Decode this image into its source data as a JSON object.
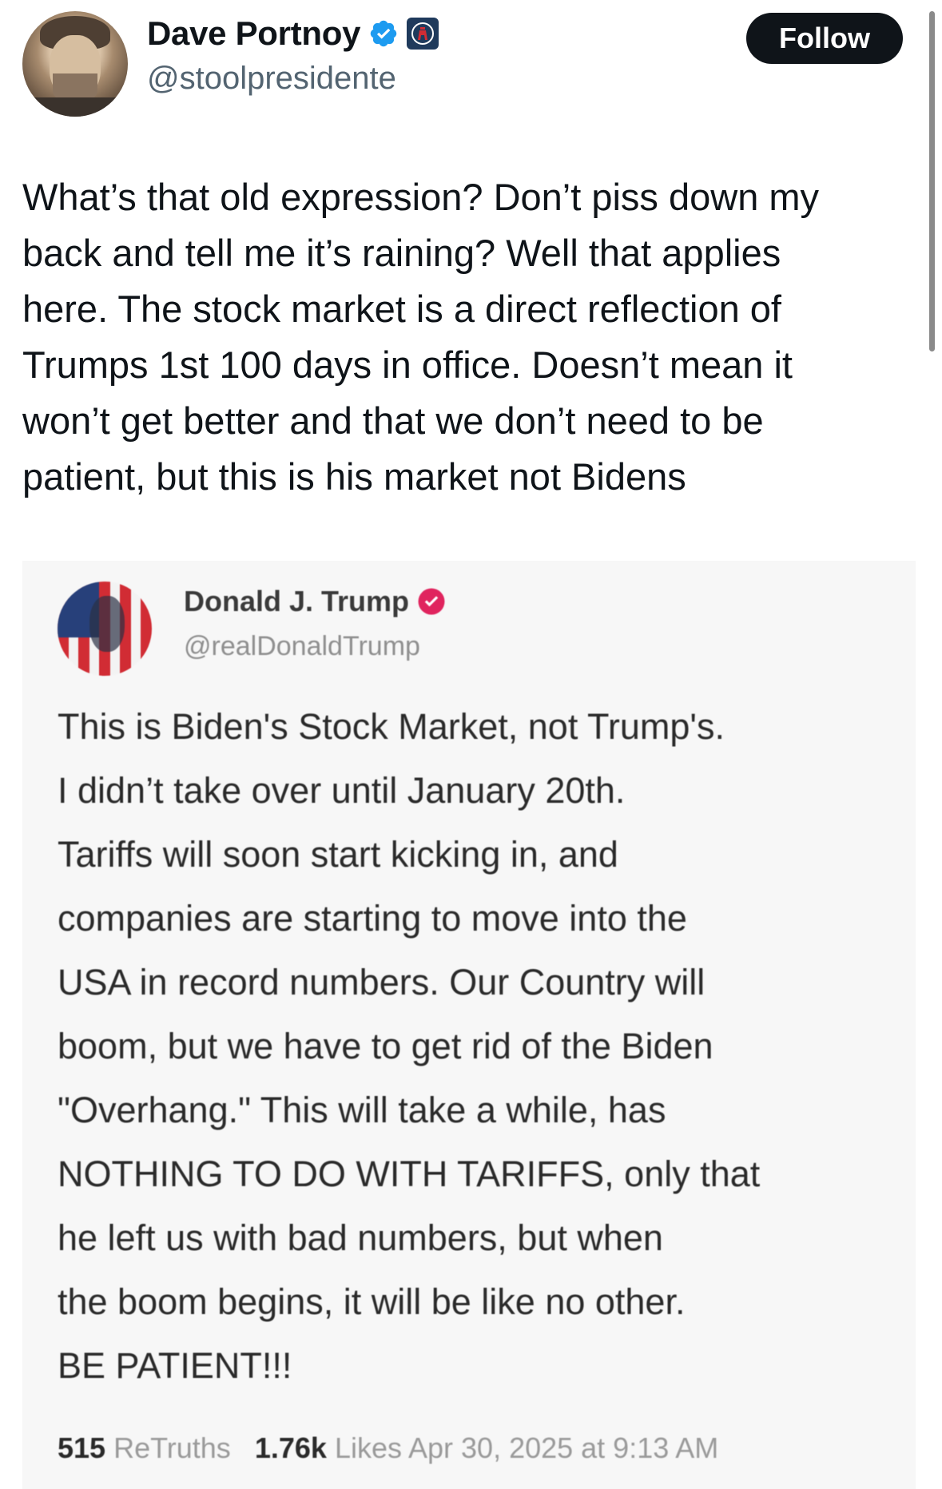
{
  "author": {
    "name": "Dave Portnoy",
    "handle": "@stoolpresidente",
    "verified_color": "#1d9bf0",
    "affiliate_icon": "barstool-icon"
  },
  "follow_label": "Follow",
  "tweet_text": "What’s that old expression? Don’t piss down my\nback and tell me it’s raining? Well that applies\nhere. The stock market is a direct reflection of\nTrumps 1st 100 days in office. Doesn’t mean it\nwon’t get better and that we don’t need to be\npatient, but this is his market not Bidens",
  "embedded_post": {
    "name": "Donald J. Trump",
    "handle": "@realDonaldTrump",
    "verified_color": "#e0245e",
    "text": "This is Biden's Stock Market, not Trump's.\nI didn’t take over until January 20th.\nTariffs will soon start kicking in, and\ncompanies are starting to move into the\nUSA in record numbers. Our Country will\nboom, but we have to get rid of the Biden\n\"Overhang.\" This will take a while, has\nNOTHING TO DO WITH TARIFFS, only that\nhe left us with bad numbers, but when\nthe boom begins, it will be like no other.\nBE PATIENT!!!",
    "retruths_count": "515",
    "retruths_label": "ReTruths",
    "likes_count": "1.76k",
    "likes_label": "Likes",
    "timestamp": "Apr 30, 2025 at 9:13 AM"
  }
}
